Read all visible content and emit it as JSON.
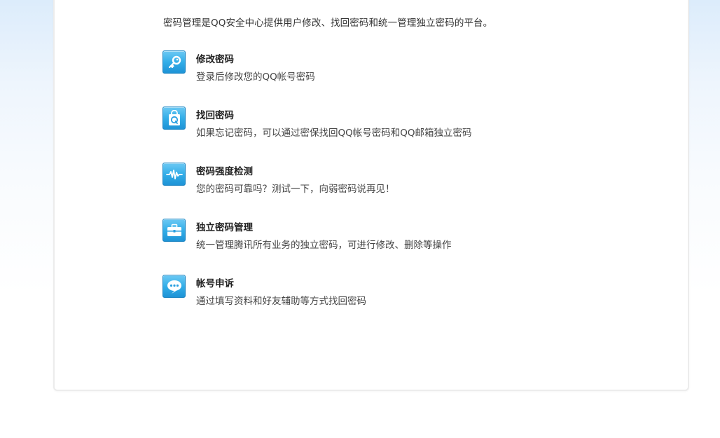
{
  "intro": "密码管理是QQ安全中心提供用户修改、找回密码和统一管理独立密码的平台。",
  "entries": [
    {
      "icon": "key-icon",
      "title": "修改密码",
      "desc": "登录后修改您的QQ帐号密码"
    },
    {
      "icon": "qq-bag-icon",
      "title": "找回密码",
      "desc": "如果忘记密码，可以通过密保找回QQ帐号密码和QQ邮箱独立密码"
    },
    {
      "icon": "waveform-icon",
      "title": "密码强度检测",
      "desc": "您的密码可靠吗？测试一下，向弱密码说再见！"
    },
    {
      "icon": "briefcase-icon",
      "title": "独立密码管理",
      "desc": "统一管理腾讯所有业务的独立密码，可进行修改、删除等操作"
    },
    {
      "icon": "chat-bubble-icon",
      "title": "帐号申诉",
      "desc": "通过填写资料和好友辅助等方式找回密码"
    }
  ],
  "colors": {
    "icon_blue": "#33aee8",
    "background_top": "#dcecfb",
    "panel_border": "#ececec"
  }
}
